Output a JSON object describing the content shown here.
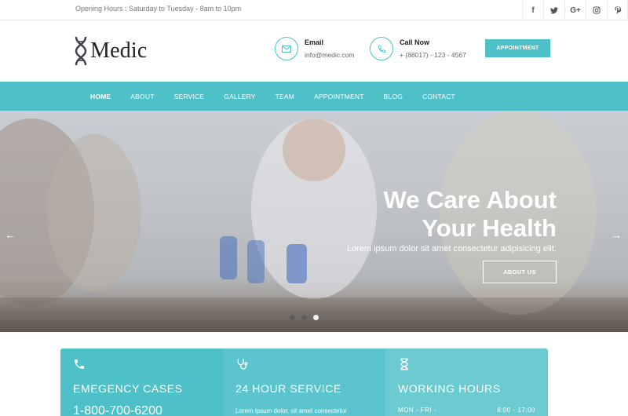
{
  "topbar": {
    "opening_hours": "Opening Hours : Saturday to Tuesday - 8am to 10pm",
    "social": [
      {
        "icon": "facebook-icon",
        "glyph": "f"
      },
      {
        "icon": "twitter-icon",
        "glyph": "t"
      },
      {
        "icon": "google-plus-icon",
        "glyph": "G+"
      },
      {
        "icon": "instagram-icon",
        "glyph": "◎"
      },
      {
        "icon": "pinterest-icon",
        "glyph": "p"
      }
    ]
  },
  "header": {
    "logo_text": "Medic",
    "email_label": "Email",
    "email_value": "info@medic.com",
    "call_label": "Call Now",
    "call_value": "+ (88017) - 123 - 4567",
    "appointment_label": "APPOINTMENT"
  },
  "nav": {
    "items": [
      "HOME",
      "ABOUT",
      "SERVICE",
      "GALLERY",
      "TEAM",
      "APPOINTMENT",
      "BLOG",
      "CONTACT"
    ],
    "active": "HOME"
  },
  "hero": {
    "title_line1": "We Care About",
    "title_line2": "Your Health",
    "subtitle": "Lorem ipsum dolor sit amet consectetur adipisicing elit.",
    "button_label": "ABOUT US",
    "prev_arrow": "←",
    "next_arrow": "→",
    "slides": 3,
    "active_slide": 3
  },
  "info_boxes": {
    "emergency": {
      "title": "EMEGENCY CASES",
      "phone": "1-800-700-6200"
    },
    "service": {
      "title": "24 HOUR SERVICE",
      "desc": "Lorem ipsum dolor, sit amet consectetur adipisicing elit. Inventore dignissimos officia"
    },
    "hours": {
      "title": "WORKING HOURS",
      "days": "MON - FRI -",
      "time": "8:00 - 17:00"
    }
  },
  "colors": {
    "accent": "#4ec0c8",
    "text_dark": "#222222",
    "muted": "#777777"
  }
}
